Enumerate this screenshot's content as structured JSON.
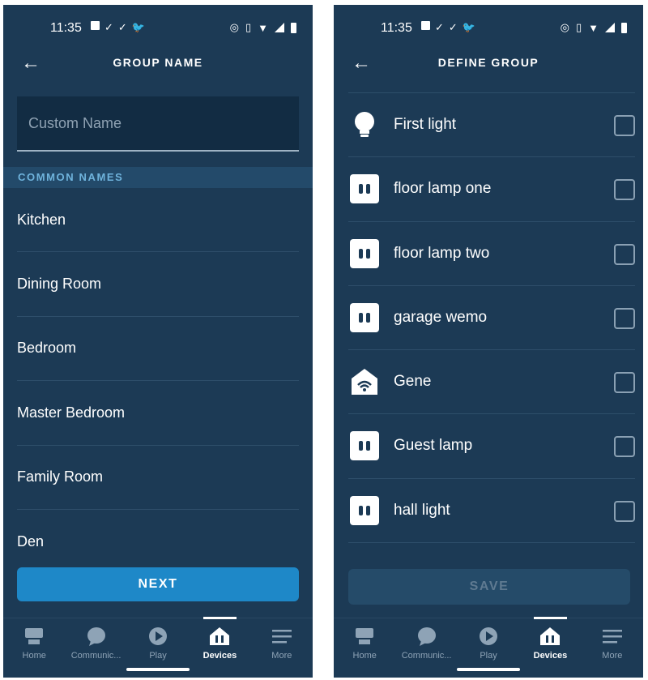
{
  "status_bar": {
    "time": "11:35"
  },
  "left_screen": {
    "header": {
      "title": "GROUP NAME"
    },
    "custom_name": {
      "placeholder": "Custom Name",
      "value": ""
    },
    "section_title": "COMMON NAMES",
    "common_names": [
      "Kitchen",
      "Dining Room",
      "Bedroom",
      "Master Bedroom",
      "Family Room",
      "Den"
    ],
    "next_label": "NEXT"
  },
  "right_screen": {
    "header": {
      "title": "DEFINE GROUP"
    },
    "devices": [
      {
        "label": "First light",
        "icon": "bulb-icon",
        "checked": false
      },
      {
        "label": "floor lamp one",
        "icon": "smart-plug-icon",
        "checked": false
      },
      {
        "label": "floor lamp two",
        "icon": "smart-plug-icon",
        "checked": false
      },
      {
        "label": "garage wemo",
        "icon": "smart-plug-icon",
        "checked": false
      },
      {
        "label": "Gene",
        "icon": "smart-home-icon",
        "checked": false
      },
      {
        "label": "Guest lamp",
        "icon": "smart-plug-icon",
        "checked": false
      },
      {
        "label": "hall light",
        "icon": "smart-plug-icon",
        "checked": false
      }
    ],
    "save_label": "SAVE"
  },
  "bottom_nav": {
    "items": [
      {
        "label": "Home",
        "icon": "home-icon"
      },
      {
        "label": "Communic...",
        "icon": "chat-bubble-icon"
      },
      {
        "label": "Play",
        "icon": "play-icon"
      },
      {
        "label": "Devices",
        "icon": "devices-icon",
        "active": true
      },
      {
        "label": "More",
        "icon": "menu-icon"
      }
    ]
  },
  "colors": {
    "background": "#1c3a55",
    "accent": "#1e88c8",
    "section_text": "#6fb3dc",
    "disabled_button": "#254b69"
  }
}
